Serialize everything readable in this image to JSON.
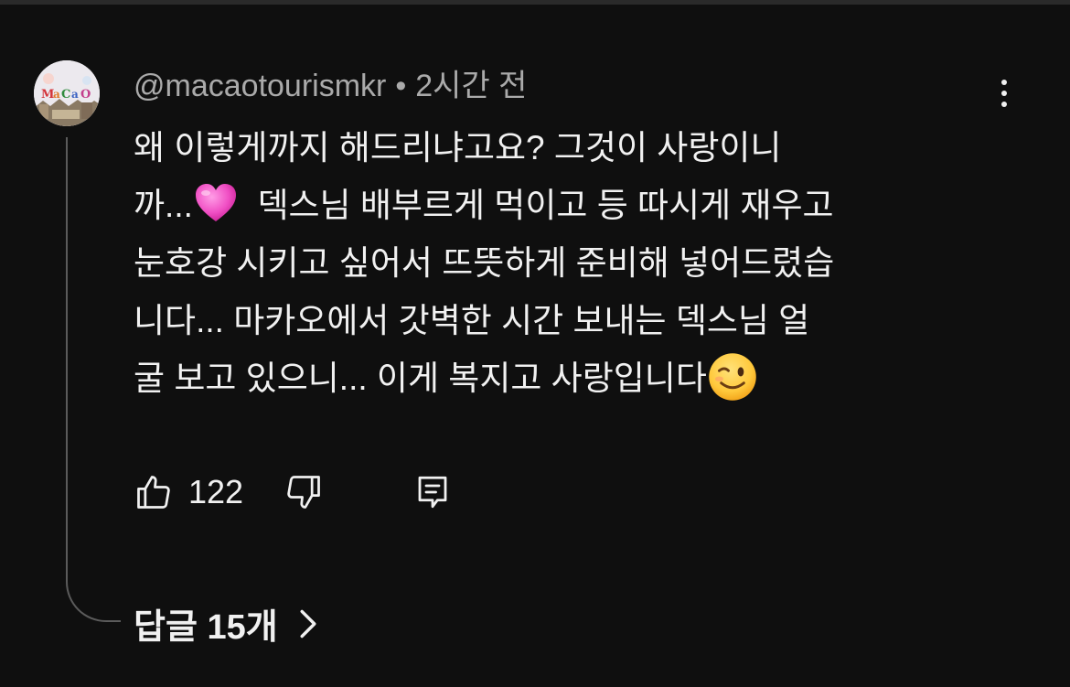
{
  "comment": {
    "author": "@macaotourismkr",
    "separator": "•",
    "time": "2시간 전",
    "avatar_text": "MaCaO",
    "lines": [
      {
        "text": "왜 이렇게까지 해드리냐고요? 그것이 사랑이니",
        "emoji": ""
      },
      {
        "text": "까...",
        "emoji": "pink-heart-emoji",
        "after": "  덱스님 배부르게 먹이고 등 따시게 재우고"
      },
      {
        "text": "눈호강 시키고 싶어서 뜨뜻하게 준비해 넣어드렸습",
        "emoji": ""
      },
      {
        "text": "니다... 마카오에서 갓벽한 시간 보내는 덱스님 얼",
        "emoji": ""
      },
      {
        "text": "굴 보고 있으니... 이게 복지고 사랑입니다",
        "emoji": "winking-face-emoji"
      }
    ]
  },
  "actions": {
    "like_count": "122",
    "like_icon": "thumbs-up-icon",
    "dislike_icon": "thumbs-down-icon",
    "reply_icon": "comment-reply-icon",
    "more_icon": "more-vertical-icon"
  },
  "replies": {
    "label": "답글 15개",
    "chevron_icon": "chevron-right-icon"
  },
  "colors": {
    "background": "#0f0f0f",
    "text_primary": "#f1f1f1",
    "text_secondary": "#aaaaaa",
    "thread_line": "#5b5b5b"
  }
}
